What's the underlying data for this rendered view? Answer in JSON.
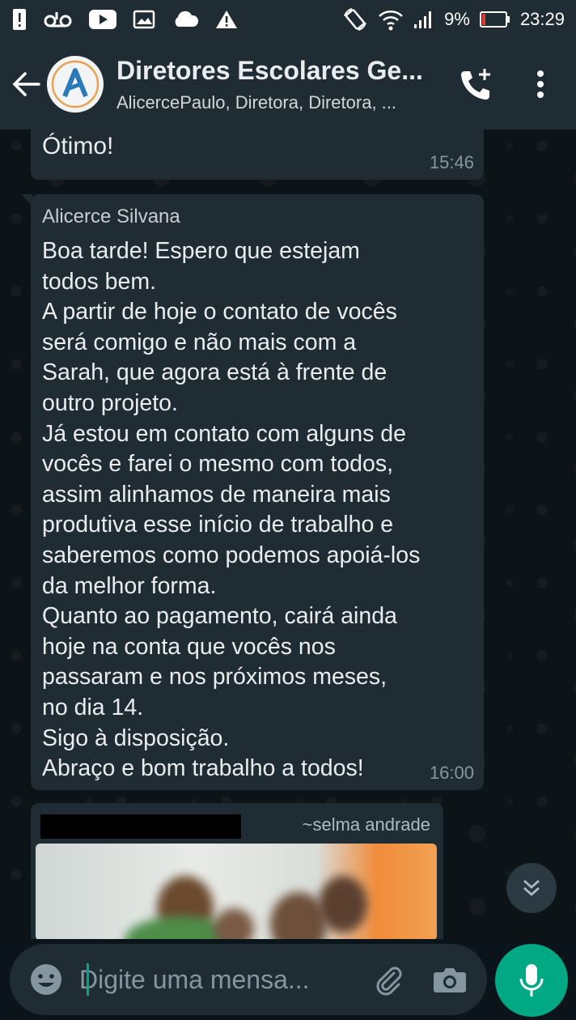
{
  "status_bar": {
    "battery_percent": "9%",
    "time": "23:29"
  },
  "header": {
    "title": "Diretores Escolares Ge...",
    "subtitle": "AlicercePaulo, Diretora, Diretora, ..."
  },
  "messages": [
    {
      "text": "Ótimo!",
      "time": "15:46"
    },
    {
      "sender": "Alicerce Silvana",
      "text": "Boa tarde! Espero que estejam\ntodos bem.\nA partir de hoje o contato de vocês\nserá comigo e não mais com a\nSarah, que agora está à frente de\noutro projeto.\nJá estou em contato com alguns de\nvocês e farei o mesmo com todos,\nassim alinhamos de maneira mais\nprodutiva esse início de trabalho e\nsaberemos como podemos apoiá-los\nda melhor forma.\nQuanto ao pagamento, cairá ainda\nhoje na conta que vocês nos\npassaram e nos próximos meses,\nno dia 14.\nSigo à disposição.\nAbraço e bom trabalho a todos!",
      "time": "16:00"
    },
    {
      "author": "~selma andrade"
    }
  ],
  "input": {
    "placeholder": "Digite uma mensa..."
  },
  "colors": {
    "accent": "#00a884",
    "bubble": "#1f2c34",
    "header": "#1f2c33"
  }
}
